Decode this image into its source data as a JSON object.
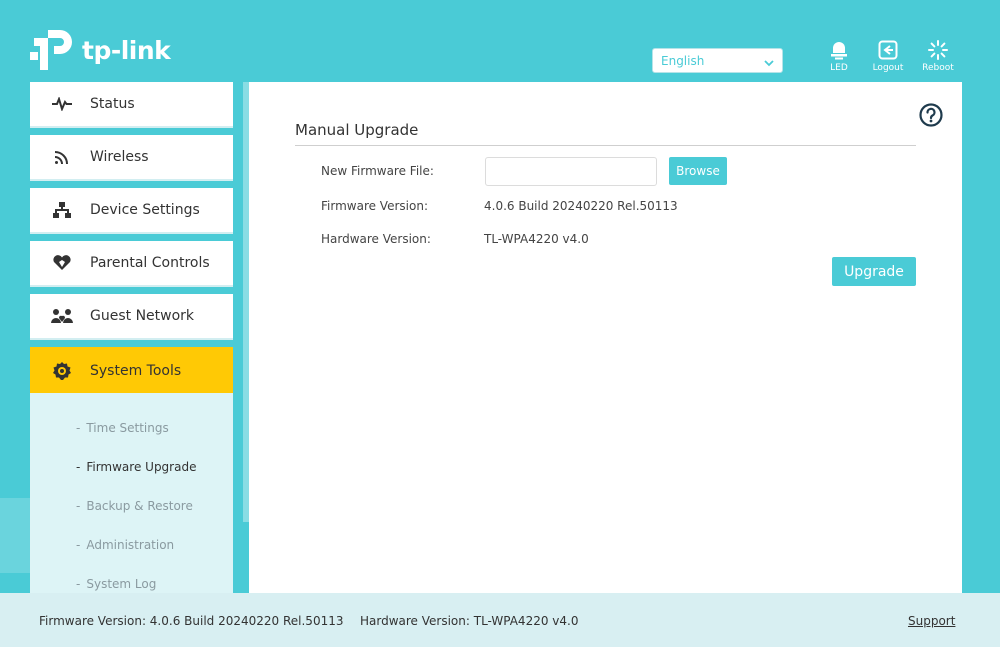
{
  "brand": {
    "logo_text": "tp-link"
  },
  "header": {
    "language": {
      "selected": "English"
    },
    "actions": [
      {
        "label": "LED",
        "icon": "led-icon"
      },
      {
        "label": "Logout",
        "icon": "logout-icon"
      },
      {
        "label": "Reboot",
        "icon": "reboot-icon"
      }
    ]
  },
  "sidebar": {
    "items": [
      {
        "label": "Status",
        "icon": "pulse-icon"
      },
      {
        "label": "Wireless",
        "icon": "wifi-icon"
      },
      {
        "label": "Device Settings",
        "icon": "network-icon"
      },
      {
        "label": "Parental Controls",
        "icon": "heart-shield-icon"
      },
      {
        "label": "Guest Network",
        "icon": "guests-icon"
      },
      {
        "label": "System Tools",
        "icon": "gear-icon",
        "active": true
      }
    ],
    "submenu": [
      {
        "label": "Time Settings"
      },
      {
        "label": "Firmware Upgrade",
        "current": true
      },
      {
        "label": "Backup & Restore"
      },
      {
        "label": "Administration"
      },
      {
        "label": "System Log"
      }
    ]
  },
  "main": {
    "section_title": "Manual Upgrade",
    "new_firmware_label": "New Firmware File:",
    "new_firmware_value": "",
    "browse_label": "Browse",
    "firmware_version_label": "Firmware Version:",
    "firmware_version_value": "4.0.6 Build 20240220 Rel.50113",
    "hardware_version_label": "Hardware Version:",
    "hardware_version_value": "TL-WPA4220 v4.0",
    "upgrade_label": "Upgrade"
  },
  "footer": {
    "firmware": "Firmware Version: 4.0.6 Build 20240220 Rel.50113",
    "hardware": "Hardware Version: TL-WPA4220 v4.0",
    "support": "Support"
  },
  "colors": {
    "background": "#4acbd6",
    "accent_active": "#ffc905",
    "button": "#4acbd6",
    "submenu_bg": "#ddf4f6",
    "footer_bg": "#d8eff2"
  }
}
